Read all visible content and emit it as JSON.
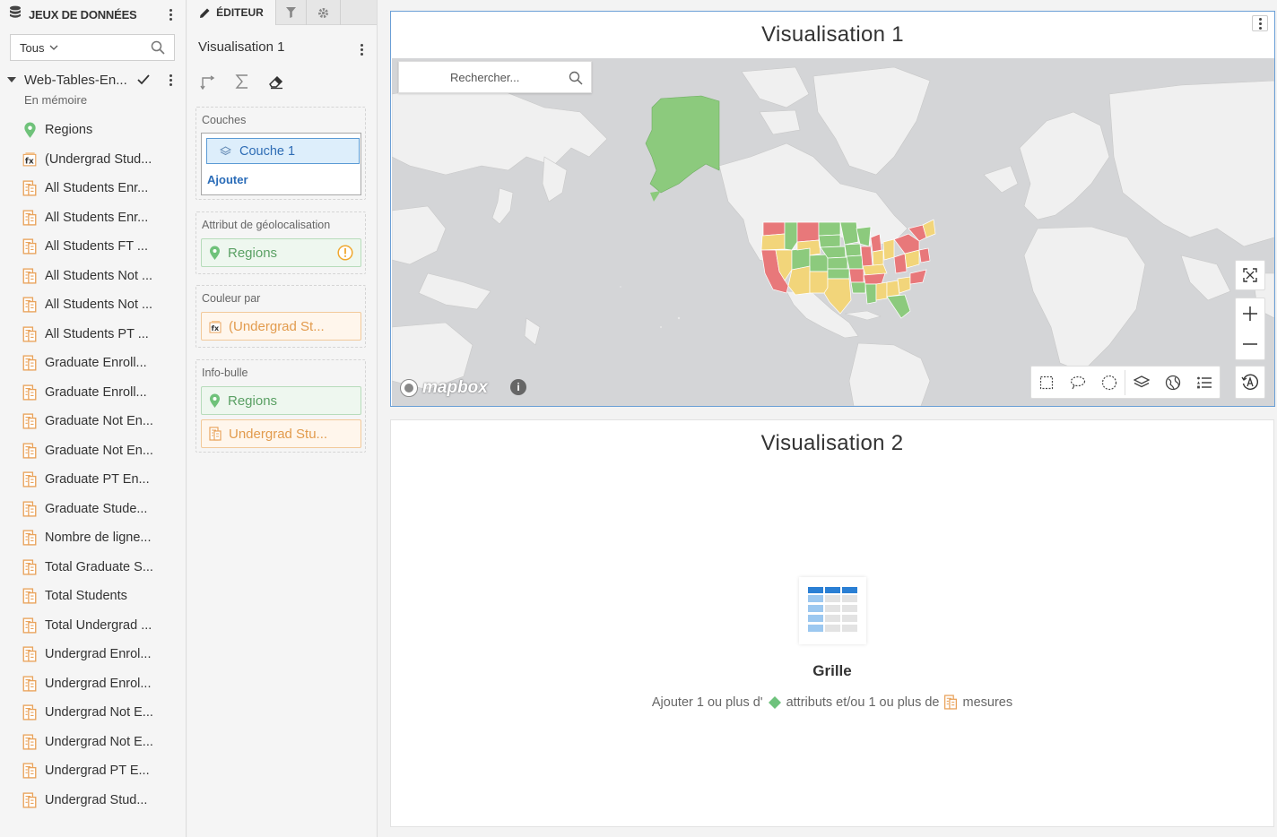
{
  "datasets_panel": {
    "title": "JEUX DE DONNÉES",
    "filter": {
      "value": "Tous"
    },
    "dataset": {
      "name": "Web-Tables-En...",
      "status": "En mémoire"
    },
    "fields": [
      {
        "label": "Regions",
        "type": "geo"
      },
      {
        "label": "(Undergrad Stud...",
        "type": "formula"
      },
      {
        "label": "All Students Enr...",
        "type": "metric"
      },
      {
        "label": "All Students Enr...",
        "type": "metric"
      },
      {
        "label": "All Students FT ...",
        "type": "metric"
      },
      {
        "label": "All Students Not ...",
        "type": "metric"
      },
      {
        "label": "All Students Not ...",
        "type": "metric"
      },
      {
        "label": "All Students PT ...",
        "type": "metric"
      },
      {
        "label": "Graduate Enroll...",
        "type": "metric"
      },
      {
        "label": "Graduate Enroll...",
        "type": "metric"
      },
      {
        "label": "Graduate Not En...",
        "type": "metric"
      },
      {
        "label": "Graduate Not En...",
        "type": "metric"
      },
      {
        "label": "Graduate PT En...",
        "type": "metric"
      },
      {
        "label": "Graduate Stude...",
        "type": "metric"
      },
      {
        "label": "Nombre de ligne...",
        "type": "metric"
      },
      {
        "label": "Total Graduate S...",
        "type": "metric"
      },
      {
        "label": "Total Students",
        "type": "metric"
      },
      {
        "label": "Total Undergrad ...",
        "type": "metric"
      },
      {
        "label": "Undergrad Enrol...",
        "type": "metric"
      },
      {
        "label": "Undergrad Enrol...",
        "type": "metric"
      },
      {
        "label": "Undergrad Not E...",
        "type": "metric"
      },
      {
        "label": "Undergrad Not E...",
        "type": "metric"
      },
      {
        "label": "Undergrad PT E...",
        "type": "metric"
      },
      {
        "label": "Undergrad Stud...",
        "type": "metric"
      }
    ]
  },
  "editor_panel": {
    "tab_editor": "ÉDITEUR",
    "viz_name": "Visualisation 1",
    "layers": {
      "label": "Couches",
      "layer": "Couche 1",
      "add": "Ajouter"
    },
    "geo": {
      "label": "Attribut de géolocalisation",
      "value": "Regions"
    },
    "color_by": {
      "label": "Couleur par",
      "value": "(Undergrad St..."
    },
    "tooltip": {
      "label": "Info-bulle",
      "values": [
        "Regions",
        "Undergrad Stu..."
      ]
    }
  },
  "canvas": {
    "viz1": {
      "title": "Visualisation 1",
      "search_placeholder": "Rechercher...",
      "attribution": "mapbox",
      "info": "i"
    },
    "viz2": {
      "title": "Visualisation 2",
      "empty_title": "Grille",
      "hint_part1": "Ajouter 1 ou plus d'",
      "hint_part2": "attributs et/ou 1 ou plus de",
      "hint_part3": "mesures"
    }
  },
  "colors": {
    "accent": "#2a6cb8",
    "geo_green": "#5aa064",
    "metric_orange": "#e29b4d",
    "map_green": "#8cca7d",
    "map_yellow": "#f2d57a",
    "map_red": "#e8787a"
  }
}
